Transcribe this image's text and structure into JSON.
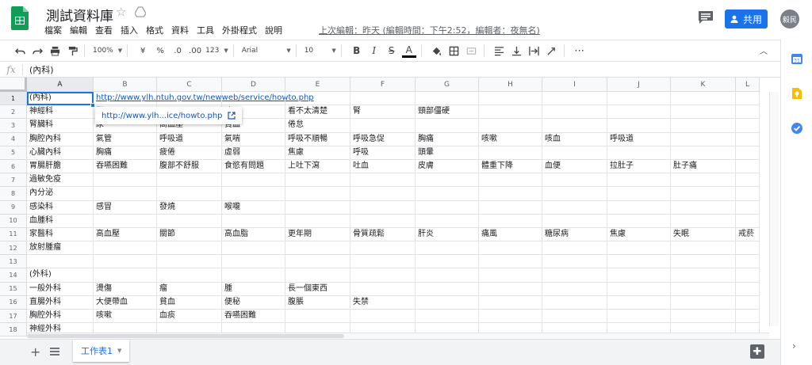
{
  "app": {
    "title": "測試資料庫",
    "menu": [
      "檔案",
      "編輯",
      "查看",
      "插入",
      "格式",
      "資料",
      "工具",
      "外掛程式",
      "說明"
    ],
    "last_edit": "上次編輯：昨天 (編輯時間：下午2:52，編輯者：夜無名)",
    "share_label": "共用",
    "avatar_label": "毅民",
    "accent": "#1a73e8"
  },
  "toolbar": {
    "zoom": "100%",
    "currency": "¥",
    "percent": "%",
    "dec_decrease": ".0",
    "dec_increase": ".00",
    "more_formats": "123",
    "font": "Arial",
    "font_size": "10",
    "bold": "B",
    "italic": "I",
    "strike": "S",
    "text_color": "A",
    "more": "⋯"
  },
  "formula": {
    "fx": "fx",
    "value": "(內科)"
  },
  "grid": {
    "columns": [
      "A",
      "B",
      "C",
      "D",
      "E",
      "F",
      "G",
      "H",
      "I",
      "J",
      "K",
      "L"
    ],
    "rows": [
      "1",
      "2",
      "3",
      "4",
      "5",
      "6",
      "7",
      "8",
      "9",
      "10",
      "11",
      "12",
      "13",
      "14",
      "15",
      "16",
      "17",
      "18"
    ],
    "cells": [
      [
        "(內科)",
        "http://www.ylh.ntuh.gov.tw/newweb/service/howto.php",
        "",
        "",
        "",
        "",
        "",
        "",
        "",
        "",
        "",
        ""
      ],
      [
        "神經科",
        "頭",
        "",
        "吐",
        "看不太清楚",
        "腎",
        "頸部僵硬",
        "",
        "",
        "",
        "",
        ""
      ],
      [
        "腎臟科",
        "尿",
        "高血壓",
        "貧血",
        "倦怠",
        "",
        "",
        "",
        "",
        "",
        "",
        ""
      ],
      [
        "胸腔內科",
        "氣管",
        "呼吸道",
        "氣喘",
        "呼吸不順暢",
        "呼吸急促",
        "胸痛",
        "咳嗽",
        "咳血",
        "呼吸道",
        "",
        ""
      ],
      [
        "心臟內科",
        "胸痛",
        "疲倦",
        "虛弱",
        "焦慮",
        "呼吸",
        "頭暈",
        "",
        "",
        "",
        "",
        ""
      ],
      [
        "胃腸肝膽",
        "吞嚥困難",
        "腹部不舒服",
        "食慾有問題",
        "上吐下瀉",
        "吐血",
        "皮膚",
        "體重下降",
        "血便",
        "拉肚子",
        "肚子痛",
        ""
      ],
      [
        "過敏免疫",
        "",
        "",
        "",
        "",
        "",
        "",
        "",
        "",
        "",
        "",
        ""
      ],
      [
        "內分泌",
        "",
        "",
        "",
        "",
        "",
        "",
        "",
        "",
        "",
        "",
        ""
      ],
      [
        "感染科",
        "感冒",
        "發燒",
        "喉嚨",
        "",
        "",
        "",
        "",
        "",
        "",
        "",
        ""
      ],
      [
        "血腫科",
        "",
        "",
        "",
        "",
        "",
        "",
        "",
        "",
        "",
        "",
        ""
      ],
      [
        "家醫科",
        "高血壓",
        "關節",
        "高血脂",
        "更年期",
        "骨質疏鬆",
        "肝炎",
        "痛風",
        "糖尿病",
        "焦慮",
        "失眠",
        "戒菸"
      ],
      [
        "放射腫瘤",
        "",
        "",
        "",
        "",
        "",
        "",
        "",
        "",
        "",
        "",
        ""
      ],
      [
        "",
        "",
        "",
        "",
        "",
        "",
        "",
        "",
        "",
        "",
        "",
        ""
      ],
      [
        "(外科)",
        "",
        "",
        "",
        "",
        "",
        "",
        "",
        "",
        "",
        "",
        ""
      ],
      [
        "一般外科",
        "燙傷",
        "瘤",
        "腫",
        "長一個東西",
        "",
        "",
        "",
        "",
        "",
        "",
        ""
      ],
      [
        "直腸外科",
        "大便帶血",
        "貧血",
        "便秘",
        "腹脹",
        "失禁",
        "",
        "",
        "",
        "",
        "",
        ""
      ],
      [
        "胸腔外科",
        "咳嗽",
        "血痰",
        "吞嚥困難",
        "",
        "",
        "",
        "",
        "",
        "",
        "",
        ""
      ],
      [
        "神經外科",
        "",
        "",
        "",
        "",
        "",
        "",
        "",
        "",
        "",
        "",
        ""
      ]
    ],
    "link_popup": "http://www.ylh...ice/howto.php"
  },
  "sheets": {
    "tabs": [
      "工作表1"
    ]
  }
}
